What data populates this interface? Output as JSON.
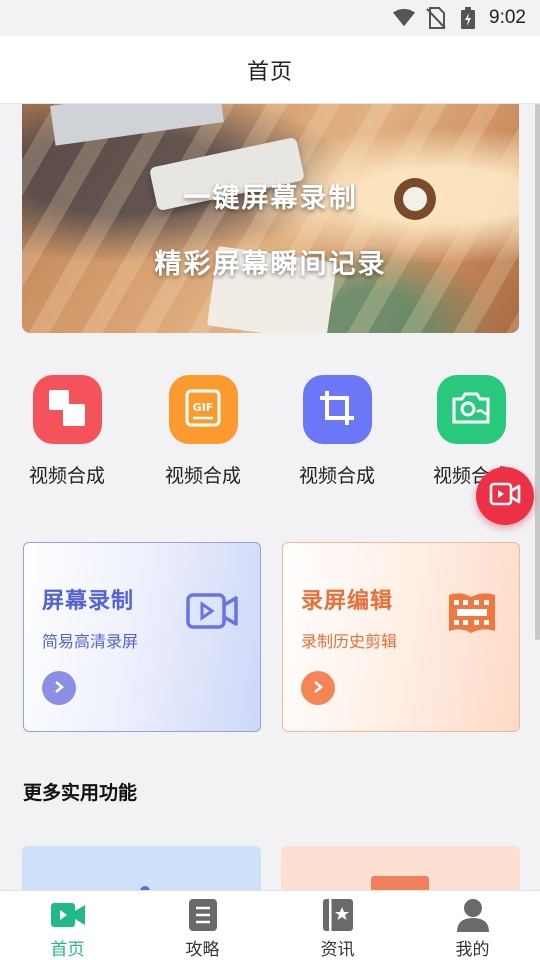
{
  "status_bar": {
    "time": "9:02",
    "icons": [
      "wifi-icon",
      "no-sim-icon",
      "battery-charging-icon"
    ]
  },
  "header": {
    "title": "首页"
  },
  "banner": {
    "line1": "一键屏幕录制",
    "line2": "精彩屏幕瞬间记录"
  },
  "tools": [
    {
      "label": "视频合成",
      "icon": "merge-squares-icon",
      "color": "#f5535b"
    },
    {
      "label": "视频合成",
      "icon": "gif-icon",
      "color": "#fb9a2f"
    },
    {
      "label": "视频合成",
      "icon": "crop-icon",
      "color": "#6b77f7"
    },
    {
      "label": "视频合成",
      "icon": "photo-camera-icon",
      "color": "#28c87d"
    }
  ],
  "floating_button": {
    "icon": "record-video-icon",
    "color": "#ee3046"
  },
  "cards": [
    {
      "title": "屏幕录制",
      "subtitle": "简易高清录屏",
      "icon": "video-camera-icon",
      "accent": "#5462d6"
    },
    {
      "title": "录屏编辑",
      "subtitle": "录制历史剪辑",
      "icon": "film-strip-icon",
      "accent": "#e8703a"
    }
  ],
  "more": {
    "title": "更多实用功能"
  },
  "bottom_nav": [
    {
      "label": "首页",
      "icon": "video-play-icon",
      "active": true
    },
    {
      "label": "攻略",
      "icon": "document-icon",
      "active": false
    },
    {
      "label": "资讯",
      "icon": "bookmark-book-icon",
      "active": false
    },
    {
      "label": "我的",
      "icon": "person-icon",
      "active": false
    }
  ],
  "colors": {
    "active_green": "#21b98a",
    "background": "#f2f2f4"
  }
}
